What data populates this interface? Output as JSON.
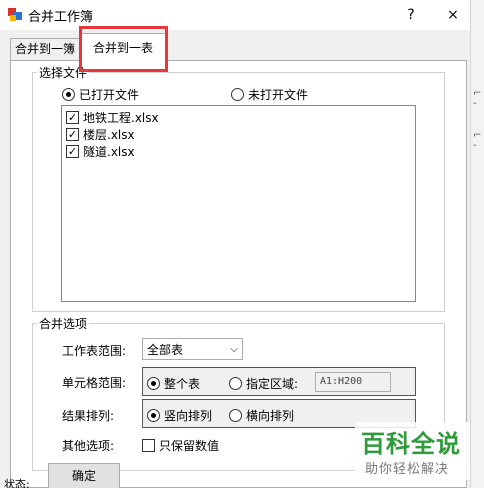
{
  "window": {
    "title": "合并工作簿",
    "help_label": "?",
    "close_label": "×"
  },
  "tabs": [
    {
      "label": "合并到一簿",
      "active": false
    },
    {
      "label": "合并到一表",
      "active": true
    }
  ],
  "select_files": {
    "legend": "选择文件",
    "radio_opened": "已打开文件",
    "radio_unopened": "未打开文件",
    "selected": "已打开文件",
    "files": [
      {
        "name": "地铁工程.xlsx",
        "checked": true
      },
      {
        "name": "楼层.xlsx",
        "checked": true
      },
      {
        "name": "隧道.xlsx",
        "checked": true
      }
    ]
  },
  "merge_options": {
    "legend": "合并选项",
    "sheet_range_label": "工作表范围:",
    "sheet_range_value": "全部表",
    "cell_range_label": "单元格范围:",
    "cell_range_whole": "整个表",
    "cell_range_specify": "指定区域:",
    "cell_range_value": "A1:H200",
    "cell_range_selected": "整个表",
    "result_order_label": "结果排列:",
    "result_vertical": "竖向排列",
    "result_horizontal": "横向排列",
    "result_selected": "竖向排列",
    "other_label": "其他选项:",
    "values_only_label": "只保留数值",
    "values_only_checked": false
  },
  "ok_label": "确定",
  "status_label": "状态:",
  "watermark": {
    "big": "百科全说",
    "small": "助你轻松解决"
  },
  "colors": {
    "highlight": "#e8363b",
    "watermark_green": "#2e9a3a"
  }
}
